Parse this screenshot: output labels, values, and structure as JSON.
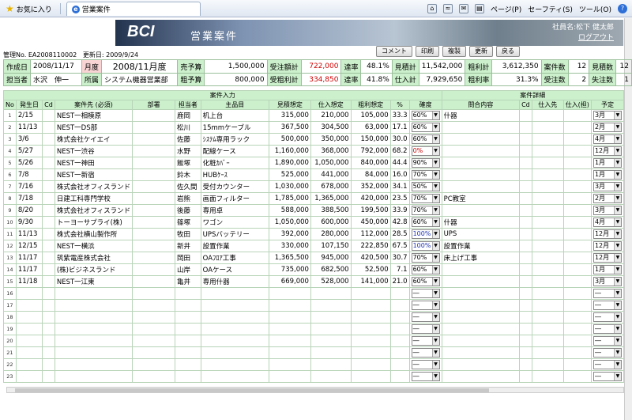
{
  "browser": {
    "favorites": "お気に入り",
    "tab_title": "営業案件",
    "menu": [
      "ページ(P)",
      "セーフティ(S)",
      "ツール(O)"
    ],
    "help": "?"
  },
  "banner": {
    "logo": "BCI",
    "title": "営業案件",
    "user": "社員名:松下 健太郎",
    "logout": "ログアウト"
  },
  "mgmt": {
    "no": "管理No. EA2008110002",
    "updated": "更新日: 2009/9/24"
  },
  "buttons": [
    "コメント",
    "印刷",
    "複製",
    "更新",
    "戻る"
  ],
  "header": {
    "row1": {
      "created_label": "作成日",
      "created": "2008/11/17",
      "month_label": "月度",
      "month": "2008/11月度",
      "sales_label": "売予算",
      "sales": "1,500,000",
      "orders_label": "受注額計",
      "orders": "722,000",
      "rate_label": "達率",
      "rate": "48.1%",
      "est_label": "見積計",
      "est": "11,542,000",
      "gp_label": "粗利計",
      "gp": "3,612,350",
      "cases_label": "案件数",
      "cases": "12",
      "estcnt_label": "見積数",
      "estcnt": "12"
    },
    "row2": {
      "staff_label": "担当者",
      "staff": "水沢　伸一",
      "dept_label": "所属",
      "dept": "システム機器営業部",
      "gpbud_label": "粗予算",
      "gpbud": "800,000",
      "gpord_label": "受粗利計",
      "gpord": "334,850",
      "rate_label": "達率",
      "rate": "41.8%",
      "purch_label": "仕入計",
      "purch": "7,929,650",
      "gpr_label": "粗利率",
      "gpr": "31.3%",
      "won_label": "受注数",
      "won": "2",
      "lost_label": "失注数",
      "lost": "1"
    }
  },
  "grid": {
    "group1": "案件入力",
    "group2": "案件詳細",
    "columns": [
      "No",
      "発生日",
      "Cd",
      "案件先 (必須)",
      "部署",
      "担当者",
      "主品目",
      "見積想定",
      "仕入想定",
      "粗利想定",
      "%",
      "確度",
      "問合内容",
      "Cd",
      "仕入先",
      "仕入(担)",
      "予定"
    ],
    "rows": [
      [
        "1",
        "2/15",
        "",
        "NEST一相模原",
        "",
        "鹿岡",
        "机上台",
        "315,000",
        "210,000",
        "105,000",
        "33.3",
        "60%",
        "什器",
        "",
        "",
        "",
        "3月"
      ],
      [
        "2",
        "11/13",
        "",
        "NEST一DS部",
        "",
        "松川",
        "15mmケーブル",
        "367,500",
        "304,500",
        "63,000",
        "17.1",
        "60%",
        "",
        "",
        "",
        "",
        "2月"
      ],
      [
        "3",
        "3/6",
        "",
        "株式会社ケイエイ",
        "",
        "佐藤",
        "ｼｽﾃﾑ専用ラック",
        "500,000",
        "350,000",
        "150,000",
        "30.0",
        "60%",
        "",
        "",
        "",
        "",
        "4月"
      ],
      [
        "4",
        "5/27",
        "",
        "NEST一渋谷",
        "",
        "水野",
        "配線ケース",
        "1,160,000",
        "368,000",
        "792,000",
        "68.2",
        "0%",
        "",
        "",
        "",
        "",
        "12月"
      ],
      [
        "5",
        "5/26",
        "",
        "NEST一神田",
        "",
        "飯塚",
        "化粧ｶﾊﾞｰ",
        "1,890,000",
        "1,050,000",
        "840,000",
        "44.4",
        "90%",
        "",
        "",
        "",
        "",
        "1月"
      ],
      [
        "6",
        "7/8",
        "",
        "NEST一新宿",
        "",
        "鈴木",
        "HUBｹｰｽ",
        "525,000",
        "441,000",
        "84,000",
        "16.0",
        "70%",
        "",
        "",
        "",
        "",
        "1月"
      ],
      [
        "7",
        "7/16",
        "",
        "株式会社オフィスランド",
        "",
        "佐久間",
        "受付カウンター",
        "1,030,000",
        "678,000",
        "352,000",
        "34.1",
        "50%",
        "",
        "",
        "",
        "",
        "3月"
      ],
      [
        "8",
        "7/18",
        "",
        "日建工科専門学校",
        "",
        "岩熊",
        "画面フィルター",
        "1,785,000",
        "1,365,000",
        "420,000",
        "23.5",
        "70%",
        "PC教室",
        "",
        "",
        "",
        "2月"
      ],
      [
        "9",
        "8/20",
        "",
        "株式会社オフィスランド",
        "",
        "後藤",
        "専用卓",
        "588,000",
        "388,500",
        "199,500",
        "33.9",
        "70%",
        "",
        "",
        "",
        "",
        "3月"
      ],
      [
        "10",
        "9/30",
        "",
        "トーヨーサプライ(株)",
        "",
        "篠塚",
        "ワゴン",
        "1,050,000",
        "600,000",
        "450,000",
        "42.8",
        "60%",
        "什器",
        "",
        "",
        "",
        "4月"
      ],
      [
        "11",
        "11/13",
        "",
        "株式会社横山製作所",
        "",
        "牧田",
        "UPSバッテリー",
        "392,000",
        "280,000",
        "112,000",
        "28.5",
        "100%",
        "UPS",
        "",
        "",
        "",
        "12月"
      ],
      [
        "12",
        "12/15",
        "",
        "NEST一横浜",
        "",
        "新井",
        "設置作業",
        "330,000",
        "107,150",
        "222,850",
        "67.5",
        "100%",
        "設置作業",
        "",
        "",
        "",
        "12月"
      ],
      [
        "13",
        "11/17",
        "",
        "筑紫電産株式会社",
        "",
        "岡田",
        "OAﾌﾛｱ工事",
        "1,365,500",
        "945,000",
        "420,500",
        "30.7",
        "70%",
        "床上げ工事",
        "",
        "",
        "",
        "12月"
      ],
      [
        "14",
        "11/17",
        "",
        "(株)ビジネスランド",
        "",
        "山岸",
        "OAケース",
        "735,000",
        "682,500",
        "52,500",
        "7.1",
        "60%",
        "",
        "",
        "",
        "",
        "1月"
      ],
      [
        "15",
        "11/18",
        "",
        "NEST一江東",
        "",
        "亀井",
        "専用什器",
        "669,000",
        "528,000",
        "141,000",
        "21.0",
        "60%",
        "",
        "",
        "",
        "",
        "3月"
      ],
      [
        "16",
        "",
        "",
        "",
        "",
        "",
        "",
        "",
        "",
        "",
        "",
        "―",
        "",
        "",
        "",
        "",
        "―"
      ],
      [
        "17",
        "",
        "",
        "",
        "",
        "",
        "",
        "",
        "",
        "",
        "",
        "―",
        "",
        "",
        "",
        "",
        "―"
      ],
      [
        "18",
        "",
        "",
        "",
        "",
        "",
        "",
        "",
        "",
        "",
        "",
        "―",
        "",
        "",
        "",
        "",
        "―"
      ],
      [
        "19",
        "",
        "",
        "",
        "",
        "",
        "",
        "",
        "",
        "",
        "",
        "―",
        "",
        "",
        "",
        "",
        "―"
      ],
      [
        "20",
        "",
        "",
        "",
        "",
        "",
        "",
        "",
        "",
        "",
        "",
        "―",
        "",
        "",
        "",
        "",
        "―"
      ],
      [
        "21",
        "",
        "",
        "",
        "",
        "",
        "",
        "",
        "",
        "",
        "",
        "―",
        "",
        "",
        "",
        "",
        "―"
      ],
      [
        "22",
        "",
        "",
        "",
        "",
        "",
        "",
        "",
        "",
        "",
        "",
        "―",
        "",
        "",
        "",
        "",
        "―"
      ],
      [
        "23",
        "",
        "",
        "",
        "",
        "",
        "",
        "",
        "",
        "",
        "",
        "―",
        "",
        "",
        "",
        "",
        "―"
      ]
    ]
  }
}
